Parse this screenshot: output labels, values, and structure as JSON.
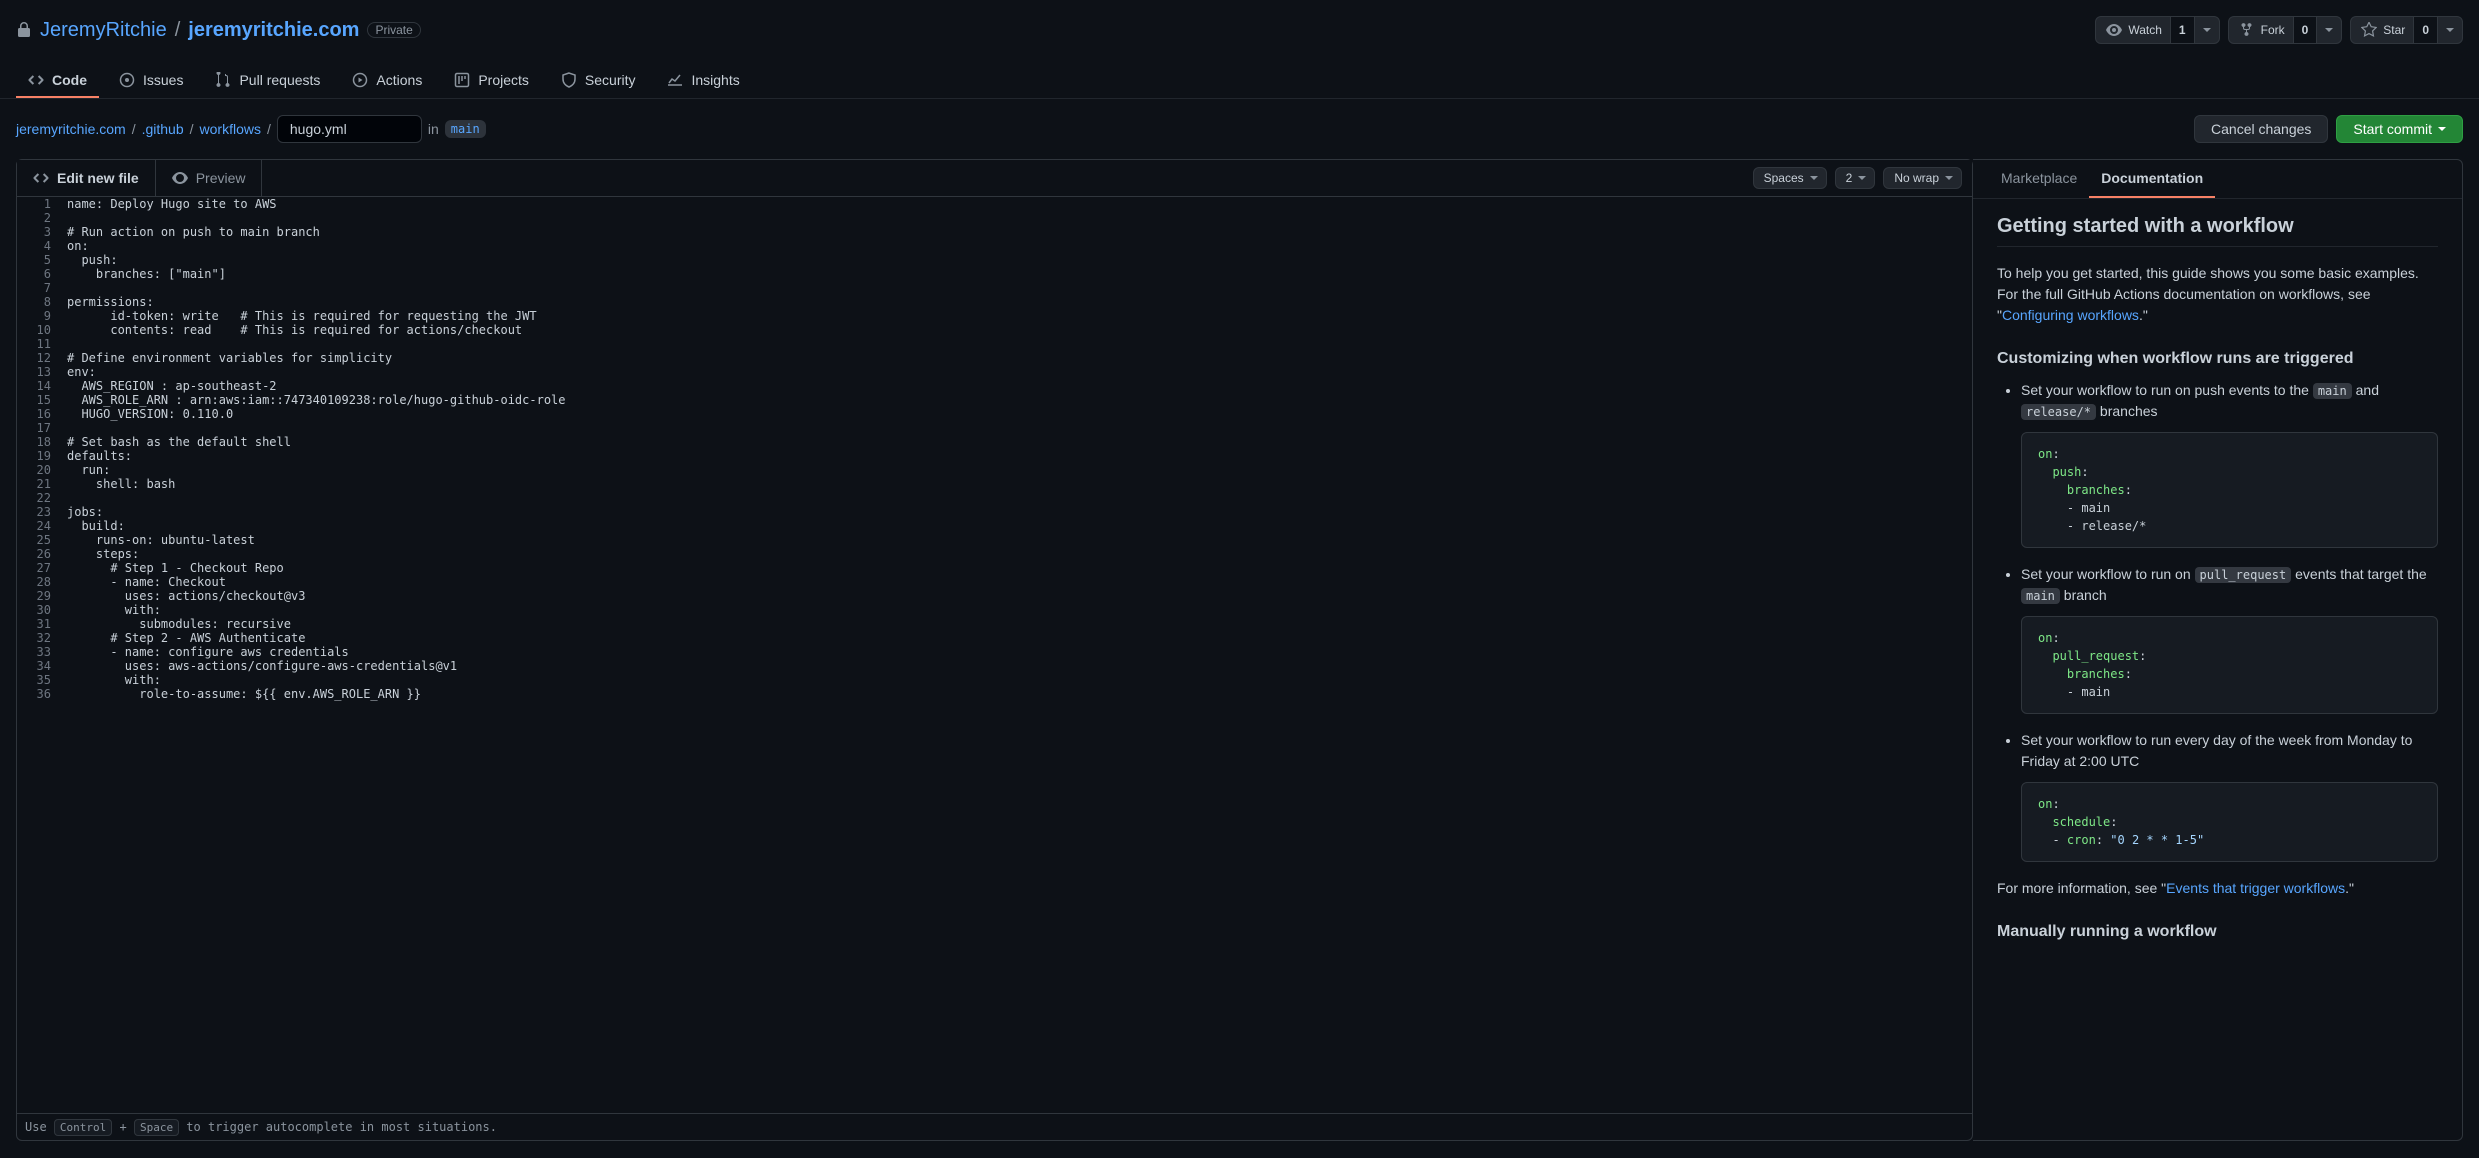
{
  "header": {
    "owner": "JeremyRitchie",
    "repo": "jeremyritchie.com",
    "visibility": "Private",
    "watch_label": "Watch",
    "watch_count": "1",
    "fork_label": "Fork",
    "fork_count": "0",
    "star_label": "Star",
    "star_count": "0"
  },
  "nav": {
    "code": "Code",
    "issues": "Issues",
    "pr": "Pull requests",
    "actions": "Actions",
    "projects": "Projects",
    "security": "Security",
    "insights": "Insights"
  },
  "crumbs": {
    "root": "jeremyritchie.com",
    "seg1": ".github",
    "seg2": "workflows",
    "filename": "hugo.yml",
    "in": "in",
    "branch": "main"
  },
  "actions_row": {
    "cancel": "Cancel changes",
    "commit": "Start commit"
  },
  "editor_tabs": {
    "edit": "Edit new file",
    "preview": "Preview",
    "indent": "Spaces",
    "size": "2",
    "wrap": "No wrap"
  },
  "code_lines": [
    "name: Deploy Hugo site to AWS",
    "",
    "# Run action on push to main branch",
    "on:",
    "  push:",
    "    branches: [\"main\"]",
    "",
    "permissions:",
    "      id-token: write   # This is required for requesting the JWT",
    "      contents: read    # This is required for actions/checkout",
    "",
    "# Define environment variables for simplicity",
    "env:",
    "  AWS_REGION : ap-southeast-2",
    "  AWS_ROLE_ARN : arn:aws:iam::747340109238:role/hugo-github-oidc-role",
    "  HUGO_VERSION: 0.110.0",
    "",
    "# Set bash as the default shell",
    "defaults:",
    "  run:",
    "    shell: bash",
    "",
    "jobs:",
    "  build:",
    "    runs-on: ubuntu-latest",
    "    steps:",
    "      # Step 1 - Checkout Repo",
    "      - name: Checkout",
    "        uses: actions/checkout@v3",
    "        with:",
    "          submodules: recursive",
    "      # Step 2 - AWS Authenticate",
    "      - name: configure aws credentials",
    "        uses: aws-actions/configure-aws-credentials@v1",
    "        with:",
    "          role-to-assume: ${{ env.AWS_ROLE_ARN }}"
  ],
  "footer": {
    "pre": "Use ",
    "k1": "Control",
    "plus": " + ",
    "k2": "Space",
    "post": " to trigger autocomplete in most situations."
  },
  "side": {
    "tab_market": "Marketplace",
    "tab_docs": "Documentation",
    "h2": "Getting started with a workflow",
    "intro_a": "To help you get started, this guide shows you some basic examples. For the full GitHub Actions documentation on workflows, see \"",
    "intro_link": "Configuring workflows",
    "intro_b": ".\"",
    "h3_1": "Customizing when workflow runs are triggered",
    "li1_a": "Set your workflow to run on push events to the ",
    "li1_main": "main",
    "li1_and": " and ",
    "li1_rel": "release/*",
    "li1_b": " branches",
    "li2_a": "Set your workflow to run on ",
    "li2_pr": "pull_request",
    "li2_b": " events that target the ",
    "li2_main": "main",
    "li2_c": " branch",
    "li3": "Set your workflow to run every day of the week from Monday to Friday at 2:00 UTC",
    "more_a": "For more information, see \"",
    "more_link": "Events that trigger workflows",
    "more_b": ".\"",
    "h3_2": "Manually running a workflow"
  }
}
